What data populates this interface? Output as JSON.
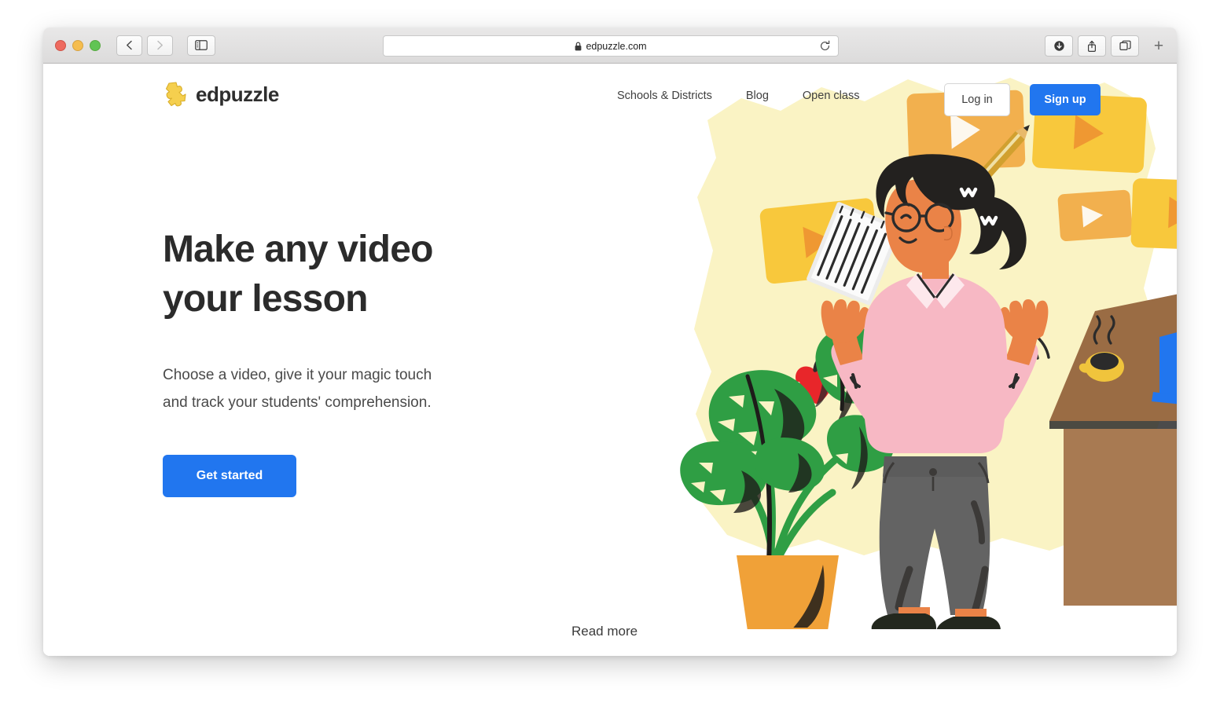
{
  "browser": {
    "url": "edpuzzle.com",
    "icons": {
      "back": "back-chevron-icon",
      "forward": "forward-chevron-icon",
      "sidebar": "sidebar-toggle-icon",
      "lock": "lock-icon",
      "reload": "reload-icon",
      "downloads": "downloads-icon",
      "share": "share-icon",
      "tabs": "tab-overview-icon",
      "newtab": "+"
    },
    "traffic_lights": [
      "close",
      "minimize",
      "zoom"
    ]
  },
  "site": {
    "logo_text": "edpuzzle",
    "nav": [
      {
        "label": "Schools & Districts"
      },
      {
        "label": "Blog"
      },
      {
        "label": "Open class"
      }
    ],
    "login_label": "Log in",
    "signup_label": "Sign up"
  },
  "hero": {
    "title_line1": "Make any video",
    "title_line2": "your lesson",
    "subtitle": "Choose a video, give it your magic touch and track your students' comprehension.",
    "cta_label": "Get started",
    "read_more_label": "Read more"
  },
  "colors": {
    "brand_blue": "#2176ef",
    "logo_yellow": "#f5cf4e",
    "blob_yellow": "#faf3c4",
    "card_yellow": "#f8c83c",
    "card_orange": "#f2b04e",
    "shirt_pink": "#f7b8c4",
    "skin_orange": "#ea8347",
    "pants_gray": "#636363",
    "plant_green": "#2f9e44",
    "pot_orange": "#f0a138",
    "desk_brown": "#9a6c44",
    "laptop_blue": "#2176ef",
    "apple_red": "#e8262a",
    "hair_black": "#23211f",
    "text_dark": "#2b2b2b"
  }
}
